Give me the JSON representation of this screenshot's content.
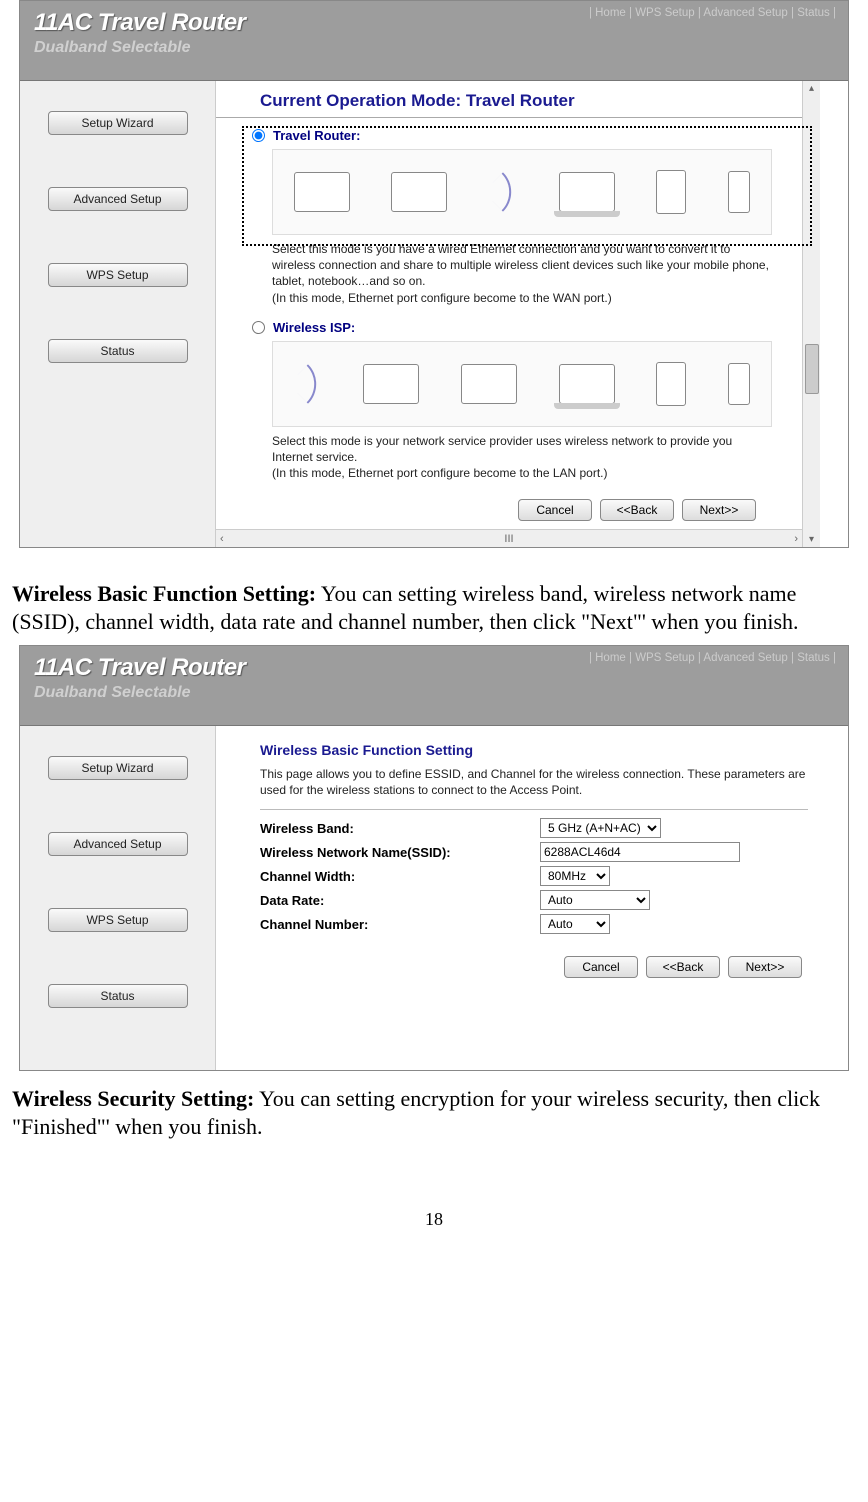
{
  "header": {
    "title": "11AC Travel Router",
    "subtitle": "Dualband Selectable",
    "nav": {
      "home": "Home",
      "wps": "WPS Setup",
      "adv": "Advanced Setup",
      "status": "Status"
    }
  },
  "sidebar": {
    "setup_wizard": "Setup Wizard",
    "advanced_setup": "Advanced Setup",
    "wps_setup": "WPS Setup",
    "status": "Status"
  },
  "ui1": {
    "mode_label": "Current Operation Mode:",
    "mode_value": "Travel Router",
    "opt1_label": "Travel Router:",
    "opt1_desc": "Select this mode is you have a wired Ethernet connection and you want to convert it to wireless connection and share to multiple wireless client devices such like your mobile phone, tablet, notebook…and so on.\n(In this mode, Ethernet port configure become to the WAN port.)",
    "opt2_label": "Wireless ISP:",
    "opt2_desc": "Select this mode is your network service provider uses wireless network to provide you Internet service.\n(In this mode, Ethernet port configure become to the LAN port.)",
    "btn_cancel": "Cancel",
    "btn_back": "<<Back",
    "btn_next": "Next>>",
    "hscroll_thumb": "III"
  },
  "para1": {
    "bold": "Wireless Basic Function Setting:",
    "text": " You can setting wireless band, wireless network name (SSID), channel width, data rate and channel number, then click \"Next\"' when you finish."
  },
  "ui2": {
    "title": "Wireless Basic Function Setting",
    "desc": "This page allows you to define ESSID, and Channel for the wireless connection. These parameters are used for the wireless stations to connect to the Access Point.",
    "f_band_lab": "Wireless Band:",
    "f_band_val": "5 GHz (A+N+AC)",
    "f_ssid_lab": "Wireless Network Name(SSID):",
    "f_ssid_val": "6288ACL46d4",
    "f_cw_lab": "Channel Width:",
    "f_cw_val": "80MHz",
    "f_rate_lab": "Data Rate:",
    "f_rate_val": "Auto",
    "f_ch_lab": "Channel Number:",
    "f_ch_val": "Auto",
    "btn_cancel": "Cancel",
    "btn_back": "<<Back",
    "btn_next": "Next>>"
  },
  "para2": {
    "bold": "Wireless Security Setting:",
    "text": " You can setting encryption for your wireless security, then click \"Finished\"' when you finish."
  },
  "page_number": "18"
}
